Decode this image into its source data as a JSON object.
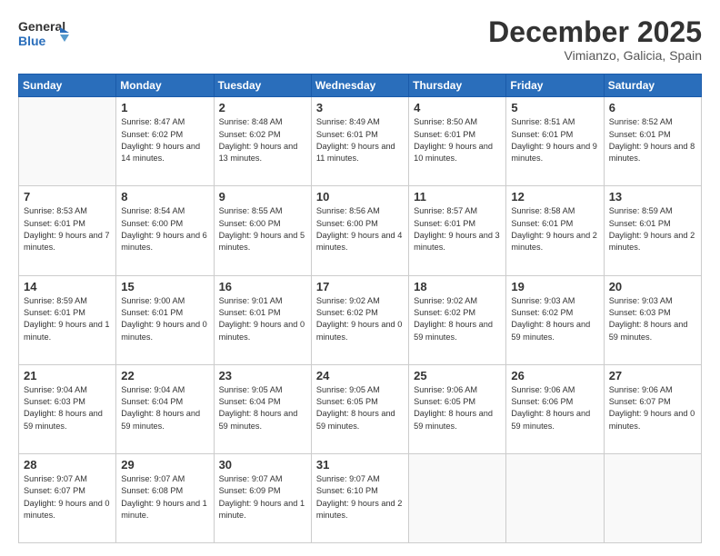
{
  "logo": {
    "line1": "General",
    "line2": "Blue"
  },
  "title": "December 2025",
  "location": "Vimianzo, Galicia, Spain",
  "weekdays": [
    "Sunday",
    "Monday",
    "Tuesday",
    "Wednesday",
    "Thursday",
    "Friday",
    "Saturday"
  ],
  "weeks": [
    [
      {
        "num": "",
        "sunrise": "",
        "sunset": "",
        "daylight": ""
      },
      {
        "num": "1",
        "sunrise": "Sunrise: 8:47 AM",
        "sunset": "Sunset: 6:02 PM",
        "daylight": "Daylight: 9 hours and 14 minutes."
      },
      {
        "num": "2",
        "sunrise": "Sunrise: 8:48 AM",
        "sunset": "Sunset: 6:02 PM",
        "daylight": "Daylight: 9 hours and 13 minutes."
      },
      {
        "num": "3",
        "sunrise": "Sunrise: 8:49 AM",
        "sunset": "Sunset: 6:01 PM",
        "daylight": "Daylight: 9 hours and 11 minutes."
      },
      {
        "num": "4",
        "sunrise": "Sunrise: 8:50 AM",
        "sunset": "Sunset: 6:01 PM",
        "daylight": "Daylight: 9 hours and 10 minutes."
      },
      {
        "num": "5",
        "sunrise": "Sunrise: 8:51 AM",
        "sunset": "Sunset: 6:01 PM",
        "daylight": "Daylight: 9 hours and 9 minutes."
      },
      {
        "num": "6",
        "sunrise": "Sunrise: 8:52 AM",
        "sunset": "Sunset: 6:01 PM",
        "daylight": "Daylight: 9 hours and 8 minutes."
      }
    ],
    [
      {
        "num": "7",
        "sunrise": "Sunrise: 8:53 AM",
        "sunset": "Sunset: 6:01 PM",
        "daylight": "Daylight: 9 hours and 7 minutes."
      },
      {
        "num": "8",
        "sunrise": "Sunrise: 8:54 AM",
        "sunset": "Sunset: 6:00 PM",
        "daylight": "Daylight: 9 hours and 6 minutes."
      },
      {
        "num": "9",
        "sunrise": "Sunrise: 8:55 AM",
        "sunset": "Sunset: 6:00 PM",
        "daylight": "Daylight: 9 hours and 5 minutes."
      },
      {
        "num": "10",
        "sunrise": "Sunrise: 8:56 AM",
        "sunset": "Sunset: 6:00 PM",
        "daylight": "Daylight: 9 hours and 4 minutes."
      },
      {
        "num": "11",
        "sunrise": "Sunrise: 8:57 AM",
        "sunset": "Sunset: 6:01 PM",
        "daylight": "Daylight: 9 hours and 3 minutes."
      },
      {
        "num": "12",
        "sunrise": "Sunrise: 8:58 AM",
        "sunset": "Sunset: 6:01 PM",
        "daylight": "Daylight: 9 hours and 2 minutes."
      },
      {
        "num": "13",
        "sunrise": "Sunrise: 8:59 AM",
        "sunset": "Sunset: 6:01 PM",
        "daylight": "Daylight: 9 hours and 2 minutes."
      }
    ],
    [
      {
        "num": "14",
        "sunrise": "Sunrise: 8:59 AM",
        "sunset": "Sunset: 6:01 PM",
        "daylight": "Daylight: 9 hours and 1 minute."
      },
      {
        "num": "15",
        "sunrise": "Sunrise: 9:00 AM",
        "sunset": "Sunset: 6:01 PM",
        "daylight": "Daylight: 9 hours and 0 minutes."
      },
      {
        "num": "16",
        "sunrise": "Sunrise: 9:01 AM",
        "sunset": "Sunset: 6:01 PM",
        "daylight": "Daylight: 9 hours and 0 minutes."
      },
      {
        "num": "17",
        "sunrise": "Sunrise: 9:02 AM",
        "sunset": "Sunset: 6:02 PM",
        "daylight": "Daylight: 9 hours and 0 minutes."
      },
      {
        "num": "18",
        "sunrise": "Sunrise: 9:02 AM",
        "sunset": "Sunset: 6:02 PM",
        "daylight": "Daylight: 8 hours and 59 minutes."
      },
      {
        "num": "19",
        "sunrise": "Sunrise: 9:03 AM",
        "sunset": "Sunset: 6:02 PM",
        "daylight": "Daylight: 8 hours and 59 minutes."
      },
      {
        "num": "20",
        "sunrise": "Sunrise: 9:03 AM",
        "sunset": "Sunset: 6:03 PM",
        "daylight": "Daylight: 8 hours and 59 minutes."
      }
    ],
    [
      {
        "num": "21",
        "sunrise": "Sunrise: 9:04 AM",
        "sunset": "Sunset: 6:03 PM",
        "daylight": "Daylight: 8 hours and 59 minutes."
      },
      {
        "num": "22",
        "sunrise": "Sunrise: 9:04 AM",
        "sunset": "Sunset: 6:04 PM",
        "daylight": "Daylight: 8 hours and 59 minutes."
      },
      {
        "num": "23",
        "sunrise": "Sunrise: 9:05 AM",
        "sunset": "Sunset: 6:04 PM",
        "daylight": "Daylight: 8 hours and 59 minutes."
      },
      {
        "num": "24",
        "sunrise": "Sunrise: 9:05 AM",
        "sunset": "Sunset: 6:05 PM",
        "daylight": "Daylight: 8 hours and 59 minutes."
      },
      {
        "num": "25",
        "sunrise": "Sunrise: 9:06 AM",
        "sunset": "Sunset: 6:05 PM",
        "daylight": "Daylight: 8 hours and 59 minutes."
      },
      {
        "num": "26",
        "sunrise": "Sunrise: 9:06 AM",
        "sunset": "Sunset: 6:06 PM",
        "daylight": "Daylight: 8 hours and 59 minutes."
      },
      {
        "num": "27",
        "sunrise": "Sunrise: 9:06 AM",
        "sunset": "Sunset: 6:07 PM",
        "daylight": "Daylight: 9 hours and 0 minutes."
      }
    ],
    [
      {
        "num": "28",
        "sunrise": "Sunrise: 9:07 AM",
        "sunset": "Sunset: 6:07 PM",
        "daylight": "Daylight: 9 hours and 0 minutes."
      },
      {
        "num": "29",
        "sunrise": "Sunrise: 9:07 AM",
        "sunset": "Sunset: 6:08 PM",
        "daylight": "Daylight: 9 hours and 1 minute."
      },
      {
        "num": "30",
        "sunrise": "Sunrise: 9:07 AM",
        "sunset": "Sunset: 6:09 PM",
        "daylight": "Daylight: 9 hours and 1 minute."
      },
      {
        "num": "31",
        "sunrise": "Sunrise: 9:07 AM",
        "sunset": "Sunset: 6:10 PM",
        "daylight": "Daylight: 9 hours and 2 minutes."
      },
      {
        "num": "",
        "sunrise": "",
        "sunset": "",
        "daylight": ""
      },
      {
        "num": "",
        "sunrise": "",
        "sunset": "",
        "daylight": ""
      },
      {
        "num": "",
        "sunrise": "",
        "sunset": "",
        "daylight": ""
      }
    ]
  ]
}
